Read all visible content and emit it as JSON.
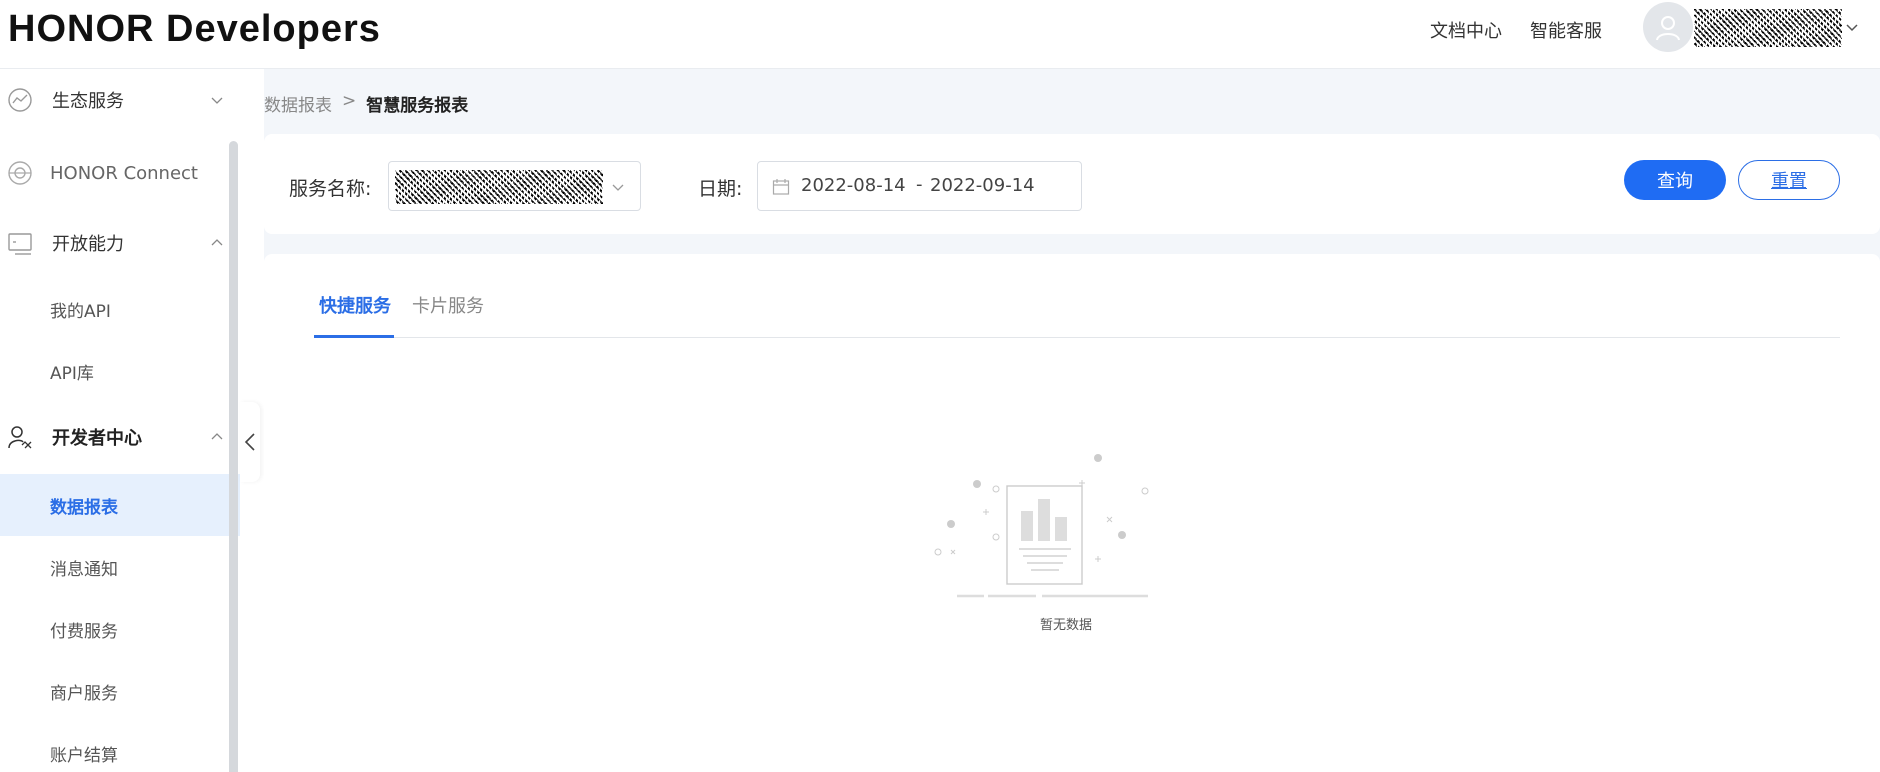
{
  "header": {
    "logo": "HONOR Developers",
    "links": [
      {
        "label": "文档中心"
      },
      {
        "label": "智能客服"
      }
    ]
  },
  "sidebar": {
    "items": [
      {
        "label": "生态服务",
        "type": "group",
        "state": "collapsed"
      },
      {
        "label": "HONOR Connect",
        "type": "group"
      },
      {
        "label": "开放能力",
        "type": "group",
        "state": "expanded"
      },
      {
        "label": "我的API",
        "type": "sub"
      },
      {
        "label": "API库",
        "type": "sub"
      },
      {
        "label": "开发者中心",
        "type": "group",
        "state": "expanded"
      },
      {
        "label": "数据报表",
        "type": "sub",
        "active": true
      },
      {
        "label": "消息通知",
        "type": "sub"
      },
      {
        "label": "付费服务",
        "type": "sub"
      },
      {
        "label": "商户服务",
        "type": "sub"
      },
      {
        "label": "账户结算",
        "type": "sub"
      }
    ]
  },
  "breadcrumb": {
    "parent": "数据报表",
    "separator": ">",
    "current": "智慧服务报表"
  },
  "filters": {
    "service_label": "服务名称:",
    "date_label": "日期:",
    "date_start": "2022-08-14",
    "date_sep": "-",
    "date_end": "2022-09-14",
    "query_button": "查询",
    "reset_button": "重置"
  },
  "tabs": [
    {
      "label": "快捷服务",
      "active": true
    },
    {
      "label": "卡片服务",
      "active": false
    }
  ],
  "empty_state": {
    "text": "暂无数据"
  },
  "colors": {
    "accent": "#1f6cf3",
    "active_bg": "#e6f0fd",
    "page_bg": "#f3f6fa"
  }
}
